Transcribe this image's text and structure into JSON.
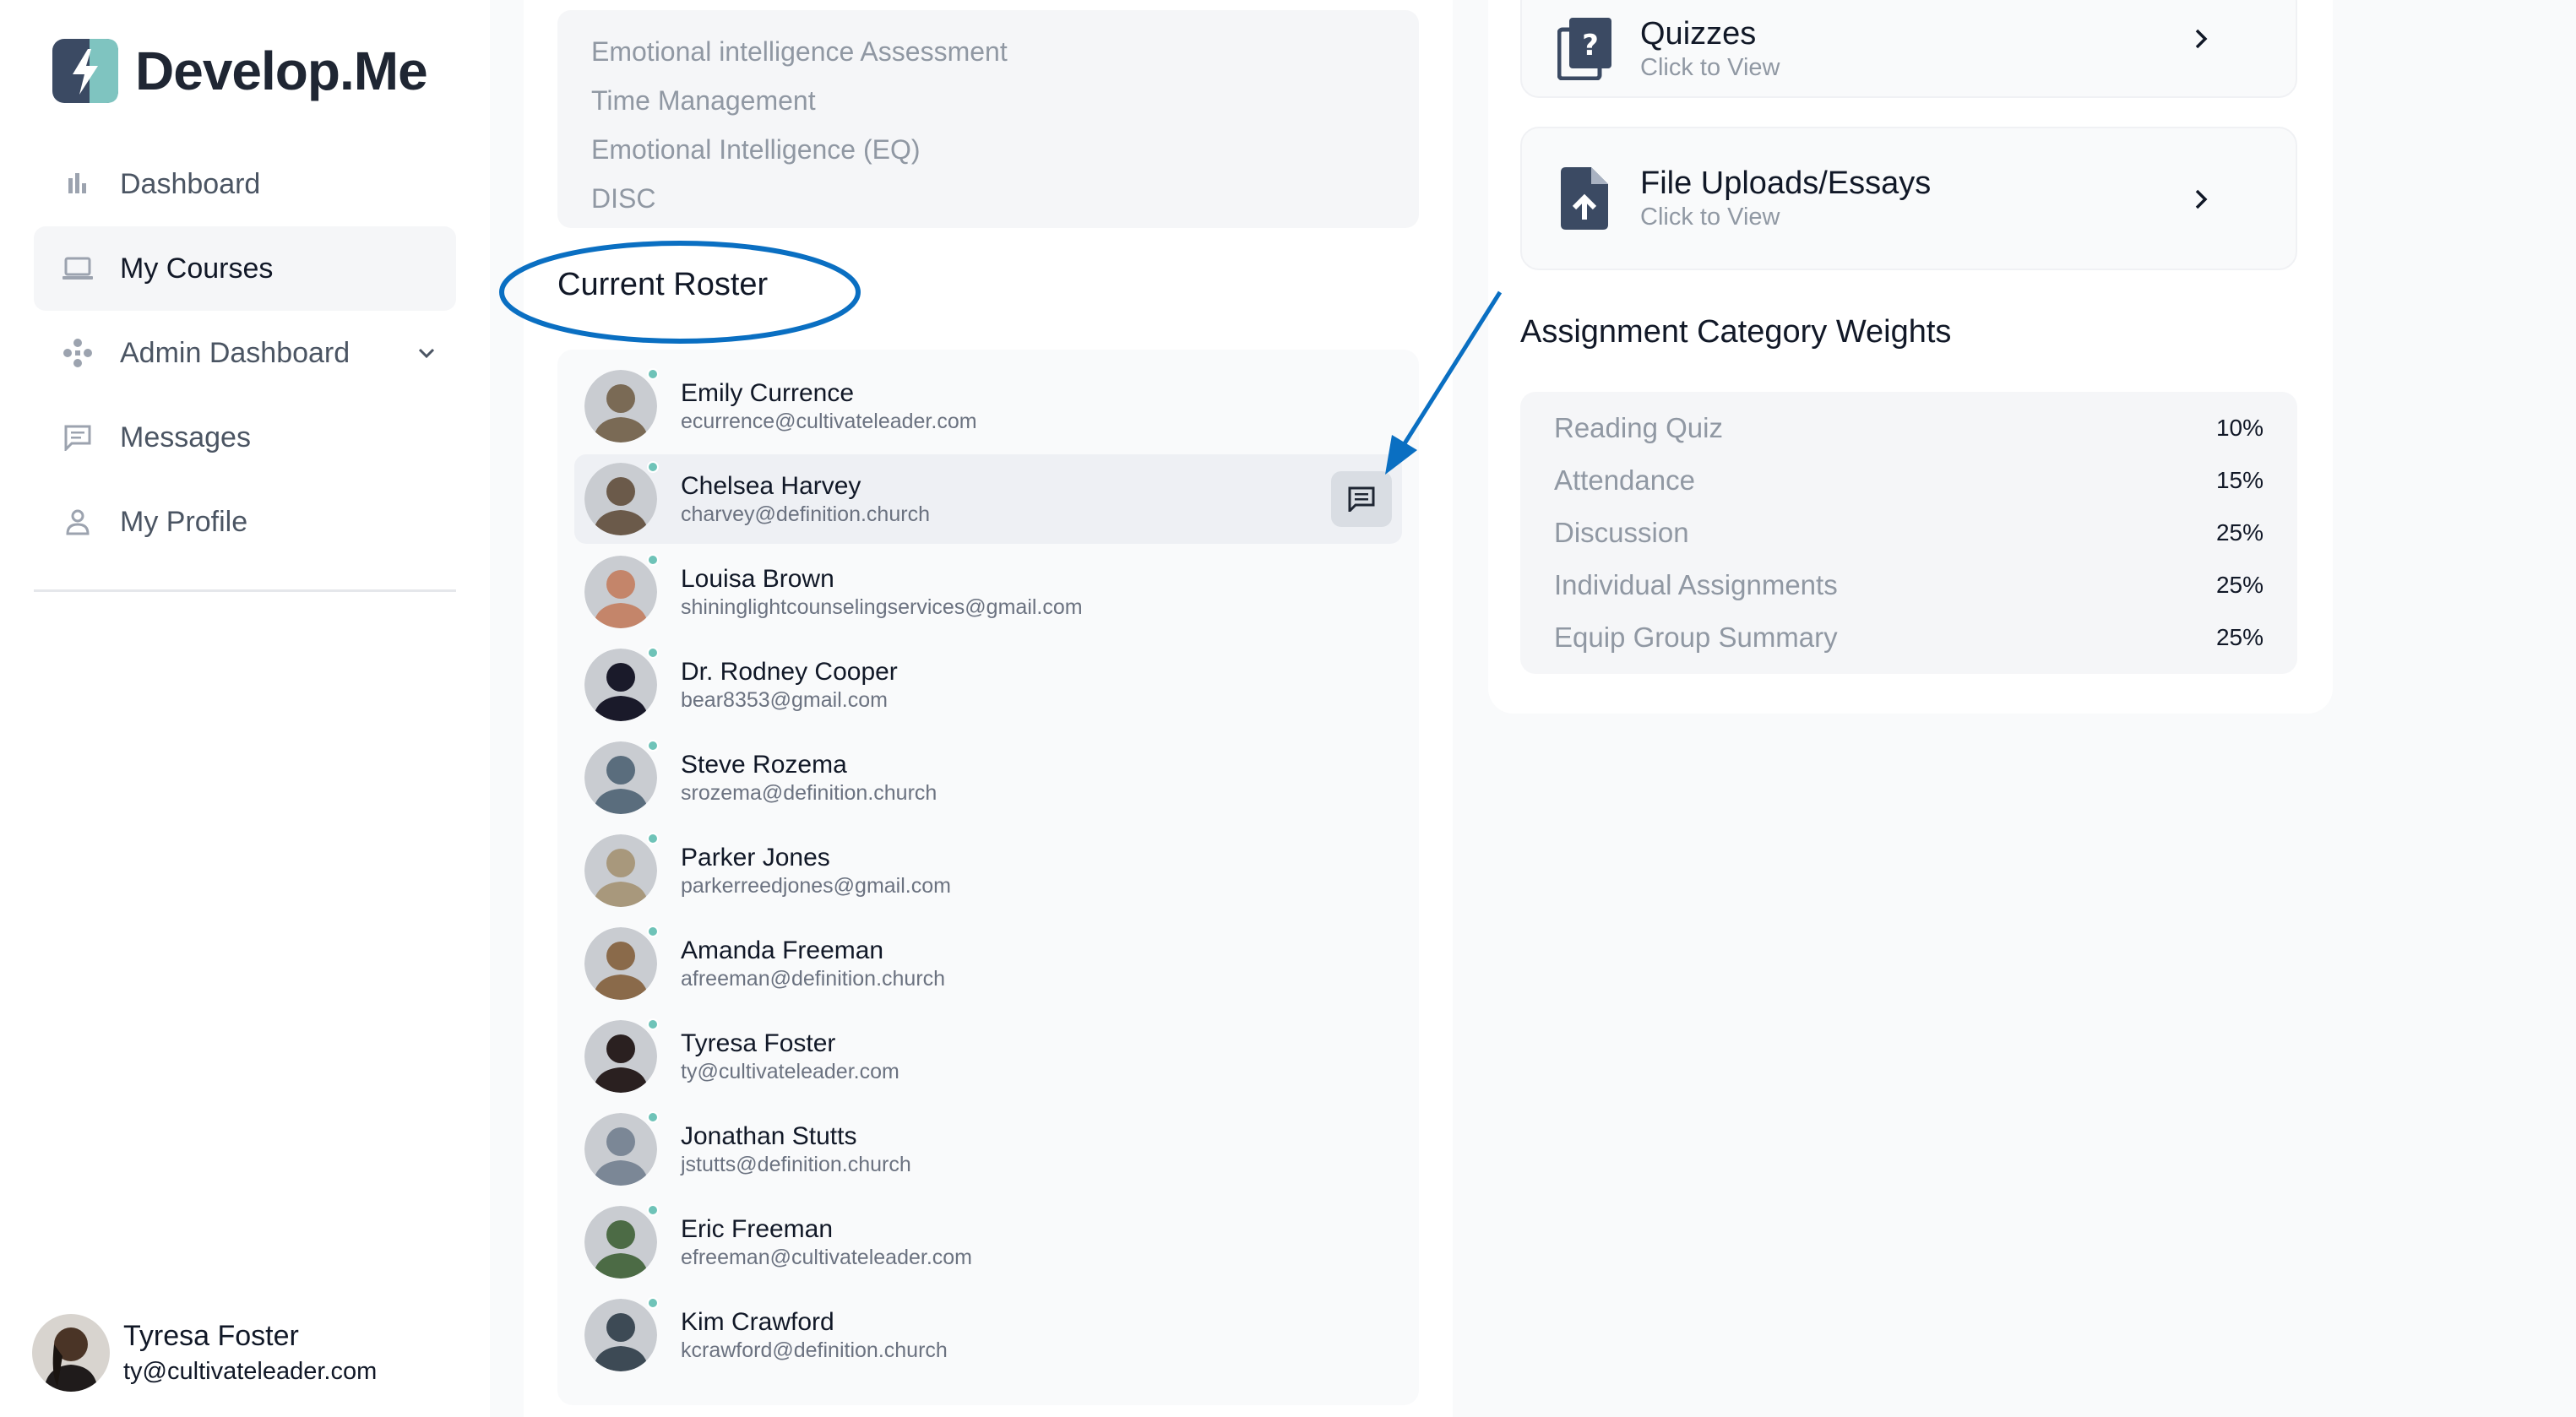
{
  "app": {
    "name": "Develop.Me"
  },
  "sidebar": {
    "items": [
      {
        "label": "Dashboard",
        "icon": "bar-chart-icon"
      },
      {
        "label": "My Courses",
        "icon": "laptop-icon",
        "active": true
      },
      {
        "label": "Admin Dashboard",
        "icon": "admin-icon",
        "expandable": true
      },
      {
        "label": "Messages",
        "icon": "message-icon"
      },
      {
        "label": "My Profile",
        "icon": "person-icon"
      }
    ],
    "user": {
      "name": "Tyresa Foster",
      "email": "ty@cultivateleader.com"
    }
  },
  "assessments": [
    "Emotional intelligence Assessment",
    "Time Management",
    "Emotional Intelligence (EQ)",
    "DISC"
  ],
  "roster": {
    "title": "Current Roster",
    "members": [
      {
        "name": "Emily Currence",
        "email": "ecurrence@cultivateleader.com",
        "color": "#7a6a55"
      },
      {
        "name": "Chelsea Harvey",
        "email": "charvey@definition.church",
        "color": "#6b5a4a"
      },
      {
        "name": "Louisa Brown",
        "email": "shininglightcounselingservices@gmail.com",
        "color": "#c4856a"
      },
      {
        "name": "Dr. Rodney Cooper",
        "email": "bear8353@gmail.com",
        "color": "#1a1a2a"
      },
      {
        "name": "Steve Rozema",
        "email": "srozema@definition.church",
        "color": "#5a6d7d"
      },
      {
        "name": "Parker Jones",
        "email": "parkerreedjones@gmail.com",
        "color": "#a8987c"
      },
      {
        "name": "Amanda Freeman",
        "email": "afreeman@definition.church",
        "color": "#8a6a4a"
      },
      {
        "name": "Tyresa Foster",
        "email": "ty@cultivateleader.com",
        "color": "#2a2020"
      },
      {
        "name": "Jonathan Stutts",
        "email": "jstutts@definition.church",
        "color": "#7b8796"
      },
      {
        "name": "Eric Freeman",
        "email": "efreeman@cultivateleader.com",
        "color": "#4c6b45"
      },
      {
        "name": "Kim Crawford",
        "email": "kcrawford@definition.church",
        "color": "#3d4a55"
      }
    ]
  },
  "tiles": [
    {
      "title": "Quizzes",
      "subtitle": "Click to View",
      "icon": "quiz-icon"
    },
    {
      "title": "File Uploads/Essays",
      "subtitle": "Click to View",
      "icon": "file-upload-icon"
    }
  ],
  "weights": {
    "title": "Assignment Category Weights",
    "rows": [
      {
        "label": "Reading Quiz",
        "value": "10%"
      },
      {
        "label": "Attendance",
        "value": "15%"
      },
      {
        "label": "Discussion",
        "value": "25%"
      },
      {
        "label": "Individual Assignments",
        "value": "25%"
      },
      {
        "label": "Equip Group Summary",
        "value": "25%"
      }
    ]
  },
  "colors": {
    "accent": "#0a6fc2",
    "online": "#6fc3b8",
    "icon_dark": "#3b4a63"
  }
}
